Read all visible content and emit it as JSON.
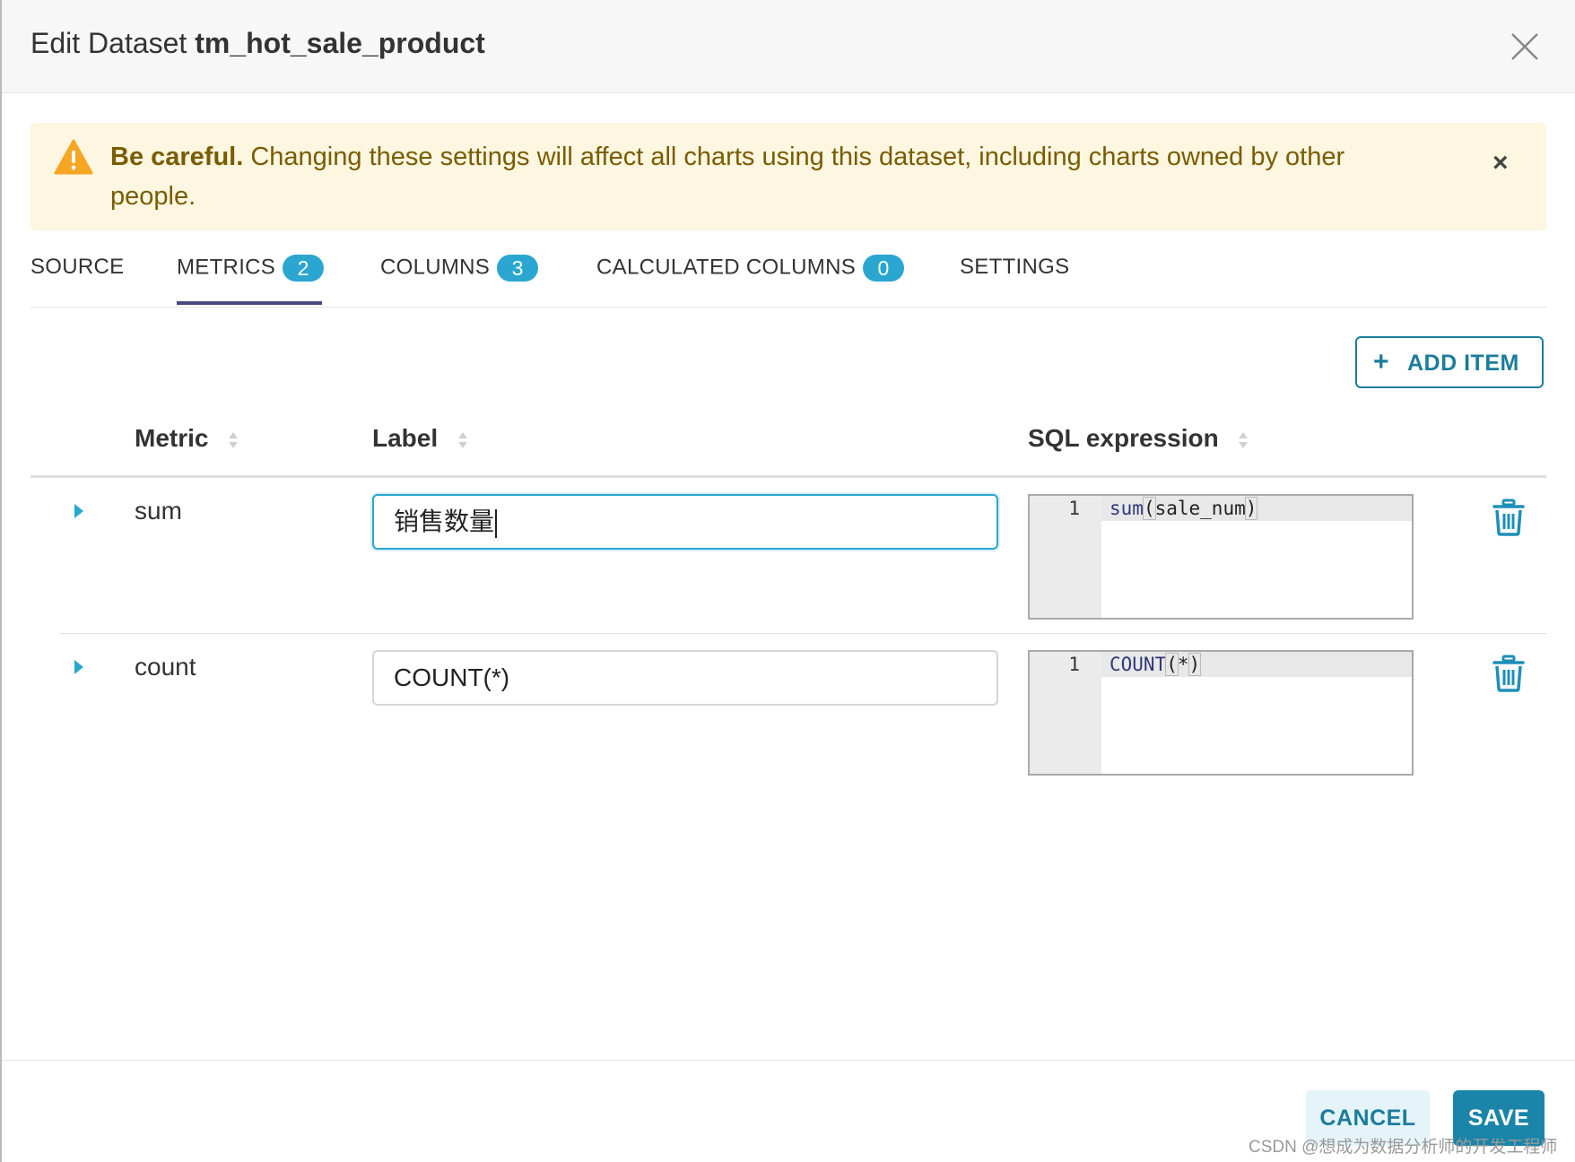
{
  "header": {
    "title_prefix": "Edit Dataset ",
    "title_dataset": "tm_hot_sale_product",
    "close_icon": "close-icon"
  },
  "alert": {
    "strong": "Be careful.",
    "message": " Changing these settings will affect all charts using this dataset, including charts owned by other people.",
    "icon": "warning-icon",
    "close_glyph": "×"
  },
  "tabs": [
    {
      "label": "SOURCE"
    },
    {
      "label": "METRICS",
      "count": "2",
      "active": true
    },
    {
      "label": "COLUMNS",
      "count": "3"
    },
    {
      "label": "CALCULATED COLUMNS",
      "count": "0"
    },
    {
      "label": "SETTINGS"
    }
  ],
  "toolbar": {
    "add_item_label": "ADD ITEM",
    "add_item_glyph": "+"
  },
  "table": {
    "headers": {
      "metric": "Metric",
      "label": "Label",
      "sql": "SQL expression"
    },
    "rows": [
      {
        "metric": "sum",
        "label": "销售数量",
        "sql_line_no": "1",
        "sql_fn": "sum",
        "sql_open": "(",
        "sql_arg": "sale_num",
        "sql_close": ")"
      },
      {
        "metric": "count",
        "label": "COUNT(*)",
        "sql_line_no": "1",
        "sql_fn": "COUNT",
        "sql_open": "(",
        "sql_arg": "*",
        "sql_close": ")"
      }
    ]
  },
  "footer": {
    "cancel_label": "CANCEL",
    "save_label": "SAVE"
  },
  "watermark": "CSDN @想成为数据分析师的开发工程师",
  "colors": {
    "accent": "#2aa6d0",
    "primary_button": "#1a85a8",
    "alert_bg": "#fdf6e0",
    "alert_text": "#7a5c00",
    "warning_icon": "#f5a623",
    "tab_underline": "#484a7d"
  }
}
